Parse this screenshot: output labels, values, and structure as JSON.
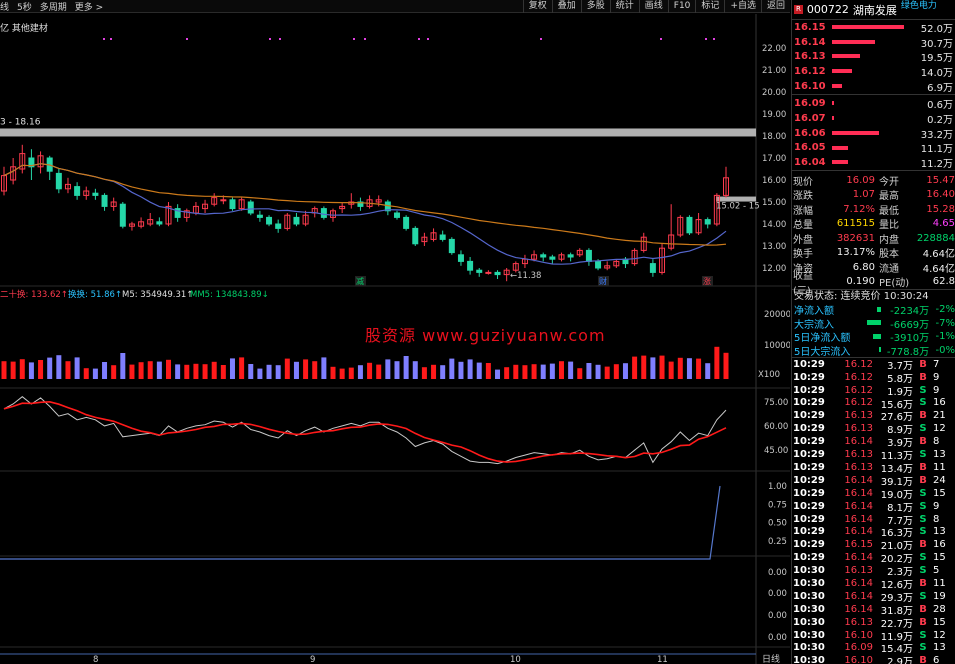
{
  "toolbar": {
    "left": [
      "线",
      "5秒",
      "多周期",
      "更多 >"
    ],
    "right": [
      "复权",
      "叠加",
      "多股",
      "统计",
      "画线",
      "F10",
      "标记",
      "+自选",
      "返回"
    ]
  },
  "chart": {
    "sector_label": "亿 其他建材",
    "range_label": "3 - 18.16",
    "high_annot": "15.02 - 15",
    "low_annot": "←11.38",
    "price_axis": [
      "22.00",
      "21.00",
      "20.00",
      "19.00",
      "18.00",
      "17.00",
      "16.00",
      "15.00",
      "14.00",
      "13.00",
      "12.00"
    ],
    "markers": [
      "减",
      "财",
      "涨"
    ],
    "vol_legend": {
      "a": "二十换: 133.62↑",
      "b": "换换: 51.86↑",
      "c": "M5: 354949.31↑",
      "d": "MM5: 134843.89↓"
    },
    "vol_axis": [
      "20000",
      "10000",
      "X100"
    ],
    "osc_axis": [
      "75.00",
      "60.00",
      "45.00"
    ],
    "ind_axis": [
      "1.00",
      "0.75",
      "0.50",
      "0.25"
    ],
    "ind2_axis": [
      "0.00",
      "0.00",
      "0.00",
      "0.00"
    ],
    "date_axis": [
      "8",
      "9",
      "10",
      "11"
    ],
    "period_label": "日线",
    "watermark": "股资源 www.guziyuanw.com",
    "colors": {
      "up": "#ff3b4e",
      "down": "#25d7a8",
      "ma_blue": "#5566cc",
      "ma_orange": "#cc7a1a"
    }
  },
  "chart_data": {
    "type": "candlestick",
    "ylim": [
      11,
      22.5
    ],
    "candles": [
      {
        "o": 15.5,
        "c": 16.2,
        "h": 16.6,
        "l": 15.3
      },
      {
        "o": 16.0,
        "c": 16.6,
        "h": 17.0,
        "l": 15.8
      },
      {
        "o": 16.5,
        "c": 17.2,
        "h": 17.6,
        "l": 16.3
      },
      {
        "o": 17.0,
        "c": 16.6,
        "h": 17.4,
        "l": 16.0
      },
      {
        "o": 16.6,
        "c": 17.1,
        "h": 17.3,
        "l": 16.3
      },
      {
        "o": 17.0,
        "c": 16.4,
        "h": 17.1,
        "l": 16.0
      },
      {
        "o": 16.3,
        "c": 15.6,
        "h": 16.5,
        "l": 15.4
      },
      {
        "o": 15.6,
        "c": 15.8,
        "h": 16.1,
        "l": 15.4
      },
      {
        "o": 15.7,
        "c": 15.3,
        "h": 15.9,
        "l": 15.1
      },
      {
        "o": 15.3,
        "c": 15.5,
        "h": 15.7,
        "l": 15.1
      },
      {
        "o": 15.4,
        "c": 15.3,
        "h": 15.6,
        "l": 15.1
      },
      {
        "o": 15.3,
        "c": 14.8,
        "h": 15.4,
        "l": 14.6
      },
      {
        "o": 14.8,
        "c": 15.0,
        "h": 15.2,
        "l": 14.6
      },
      {
        "o": 14.9,
        "c": 13.9,
        "h": 15.0,
        "l": 13.8
      },
      {
        "o": 13.9,
        "c": 14.0,
        "h": 14.1,
        "l": 13.7
      },
      {
        "o": 13.9,
        "c": 14.1,
        "h": 14.3,
        "l": 13.8
      },
      {
        "o": 14.0,
        "c": 14.2,
        "h": 14.5,
        "l": 13.9
      },
      {
        "o": 14.1,
        "c": 14.0,
        "h": 14.3,
        "l": 13.9
      },
      {
        "o": 14.0,
        "c": 14.8,
        "h": 15.0,
        "l": 13.9
      },
      {
        "o": 14.7,
        "c": 14.3,
        "h": 14.9,
        "l": 14.1
      },
      {
        "o": 14.3,
        "c": 14.6,
        "h": 14.7,
        "l": 14.1
      },
      {
        "o": 14.5,
        "c": 14.8,
        "h": 15.0,
        "l": 14.4
      },
      {
        "o": 14.7,
        "c": 14.9,
        "h": 15.1,
        "l": 14.5
      },
      {
        "o": 14.9,
        "c": 15.2,
        "h": 15.4,
        "l": 14.8
      },
      {
        "o": 15.1,
        "c": 15.1,
        "h": 15.3,
        "l": 14.9
      },
      {
        "o": 15.1,
        "c": 14.7,
        "h": 15.2,
        "l": 14.6
      },
      {
        "o": 14.7,
        "c": 15.1,
        "h": 15.2,
        "l": 14.6
      },
      {
        "o": 15.0,
        "c": 14.5,
        "h": 15.1,
        "l": 14.4
      },
      {
        "o": 14.4,
        "c": 14.3,
        "h": 14.6,
        "l": 14.1
      },
      {
        "o": 14.3,
        "c": 14.0,
        "h": 14.4,
        "l": 13.9
      },
      {
        "o": 14.0,
        "c": 13.8,
        "h": 14.2,
        "l": 13.6
      },
      {
        "o": 13.8,
        "c": 14.4,
        "h": 14.5,
        "l": 13.7
      },
      {
        "o": 14.3,
        "c": 14.0,
        "h": 14.5,
        "l": 13.9
      },
      {
        "o": 14.0,
        "c": 14.4,
        "h": 14.6,
        "l": 13.9
      },
      {
        "o": 14.5,
        "c": 14.7,
        "h": 14.8,
        "l": 14.3
      },
      {
        "o": 14.7,
        "c": 14.3,
        "h": 14.8,
        "l": 14.2
      },
      {
        "o": 14.3,
        "c": 14.6,
        "h": 14.7,
        "l": 14.1
      },
      {
        "o": 14.7,
        "c": 14.8,
        "h": 15.0,
        "l": 14.5
      },
      {
        "o": 14.9,
        "c": 15.0,
        "h": 15.4,
        "l": 14.7
      },
      {
        "o": 15.0,
        "c": 14.8,
        "h": 15.2,
        "l": 14.6
      },
      {
        "o": 14.8,
        "c": 15.1,
        "h": 15.3,
        "l": 14.7
      },
      {
        "o": 15.0,
        "c": 15.1,
        "h": 15.3,
        "l": 14.8
      },
      {
        "o": 15.0,
        "c": 14.6,
        "h": 15.1,
        "l": 14.4
      },
      {
        "o": 14.5,
        "c": 14.3,
        "h": 14.6,
        "l": 14.2
      },
      {
        "o": 14.3,
        "c": 13.8,
        "h": 14.4,
        "l": 13.7
      },
      {
        "o": 13.8,
        "c": 13.1,
        "h": 13.9,
        "l": 13.0
      },
      {
        "o": 13.2,
        "c": 13.4,
        "h": 13.6,
        "l": 13.0
      },
      {
        "o": 13.3,
        "c": 13.6,
        "h": 13.8,
        "l": 13.2
      },
      {
        "o": 13.5,
        "c": 13.3,
        "h": 13.7,
        "l": 13.2
      },
      {
        "o": 13.3,
        "c": 12.7,
        "h": 13.4,
        "l": 12.6
      },
      {
        "o": 12.6,
        "c": 12.3,
        "h": 12.8,
        "l": 12.1
      },
      {
        "o": 12.3,
        "c": 11.9,
        "h": 12.5,
        "l": 11.7
      },
      {
        "o": 11.9,
        "c": 11.8,
        "h": 12.0,
        "l": 11.6
      },
      {
        "o": 11.8,
        "c": 11.8,
        "h": 11.9,
        "l": 11.7
      },
      {
        "o": 11.8,
        "c": 11.7,
        "h": 11.9,
        "l": 11.5
      },
      {
        "o": 11.7,
        "c": 11.9,
        "h": 12.0,
        "l": 11.4
      },
      {
        "o": 11.9,
        "c": 12.2,
        "h": 12.3,
        "l": 11.8
      },
      {
        "o": 12.2,
        "c": 12.4,
        "h": 12.6,
        "l": 12.0
      },
      {
        "o": 12.4,
        "c": 12.6,
        "h": 12.8,
        "l": 12.3
      },
      {
        "o": 12.6,
        "c": 12.5,
        "h": 12.7,
        "l": 12.3
      },
      {
        "o": 12.5,
        "c": 12.4,
        "h": 12.6,
        "l": 12.2
      },
      {
        "o": 12.4,
        "c": 12.6,
        "h": 12.7,
        "l": 12.3
      },
      {
        "o": 12.6,
        "c": 12.5,
        "h": 12.7,
        "l": 12.3
      },
      {
        "o": 12.6,
        "c": 12.8,
        "h": 12.9,
        "l": 12.5
      },
      {
        "o": 12.8,
        "c": 12.3,
        "h": 12.9,
        "l": 12.1
      },
      {
        "o": 12.3,
        "c": 12.0,
        "h": 12.4,
        "l": 11.9
      },
      {
        "o": 12.0,
        "c": 12.1,
        "h": 12.3,
        "l": 11.9
      },
      {
        "o": 12.1,
        "c": 12.3,
        "h": 12.4,
        "l": 12.0
      },
      {
        "o": 12.4,
        "c": 12.2,
        "h": 12.5,
        "l": 12.0
      },
      {
        "o": 12.2,
        "c": 12.8,
        "h": 12.9,
        "l": 12.1
      },
      {
        "o": 12.8,
        "c": 13.4,
        "h": 13.6,
        "l": 12.7
      },
      {
        "o": 12.2,
        "c": 11.8,
        "h": 12.4,
        "l": 11.6
      },
      {
        "o": 11.8,
        "c": 12.9,
        "h": 13.1,
        "l": 11.7
      },
      {
        "o": 12.9,
        "c": 13.5,
        "h": 14.9,
        "l": 12.8
      },
      {
        "o": 13.5,
        "c": 14.3,
        "h": 14.4,
        "l": 13.4
      },
      {
        "o": 14.3,
        "c": 13.6,
        "h": 14.4,
        "l": 13.5
      },
      {
        "o": 13.6,
        "c": 14.2,
        "h": 14.5,
        "l": 13.5
      },
      {
        "o": 14.2,
        "c": 14.0,
        "h": 14.3,
        "l": 13.8
      },
      {
        "o": 14.0,
        "c": 15.3,
        "h": 15.4,
        "l": 13.9
      },
      {
        "o": 15.3,
        "c": 16.1,
        "h": 16.6,
        "l": 15.2
      }
    ]
  },
  "orderbook": {
    "code": "000722",
    "name": "湖南发展",
    "alt": "绿色电力",
    "rows": [
      {
        "price": "16.15",
        "vol": "52.0万",
        "w": 0.92
      },
      {
        "price": "16.14",
        "vol": "30.7万",
        "w": 0.55
      },
      {
        "price": "16.13",
        "vol": "19.5万",
        "w": 0.36
      },
      {
        "price": "16.12",
        "vol": "14.0万",
        "w": 0.26
      },
      {
        "price": "16.10",
        "vol": "6.9万",
        "w": 0.13
      },
      {
        "price": "16.09",
        "vol": "0.6万",
        "w": 0.02
      },
      {
        "price": "16.07",
        "vol": "0.2万",
        "w": 0.01
      },
      {
        "price": "16.06",
        "vol": "33.2万",
        "w": 0.6
      },
      {
        "price": "16.05",
        "vol": "11.1万",
        "w": 0.2
      },
      {
        "price": "16.04",
        "vol": "11.2万",
        "w": 0.2
      }
    ]
  },
  "quote": [
    {
      "k": "现价",
      "v": "16.09",
      "vc": "red",
      "k2": "今开",
      "v2": "15.47",
      "v2c": "red"
    },
    {
      "k": "涨跌",
      "v": "1.07",
      "vc": "red",
      "k2": "最高",
      "v2": "16.40",
      "v2c": "red"
    },
    {
      "k": "涨幅",
      "v": "7.12%",
      "vc": "red",
      "k2": "最低",
      "v2": "15.28",
      "v2c": "red"
    },
    {
      "k": "总量",
      "v": "611515",
      "vc": "yellow",
      "k2": "量比",
      "v2": "4.65",
      "v2c": "mag"
    },
    {
      "k": "外盘",
      "v": "382631",
      "vc": "red",
      "k2": "内盘",
      "v2": "228884",
      "v2c": "green"
    },
    {
      "k": "换手",
      "v": "13.17%",
      "vc": "white",
      "k2": "股本",
      "v2": "4.64亿",
      "v2c": "white"
    },
    {
      "k": "净资",
      "v": "6.80",
      "vc": "white",
      "k2": "流通",
      "v2": "4.64亿",
      "v2c": "white"
    },
    {
      "k": "收益(三)",
      "v": "0.190",
      "vc": "white",
      "k2": "PE(动)",
      "v2": "62.8",
      "v2c": "white"
    }
  ],
  "trade_status": "交易状态: 连续竞价 10:30:24",
  "flows": [
    {
      "label": "净流入额",
      "val": "-2234万",
      "pct": "-2%",
      "w": 4
    },
    {
      "label": "大宗流入",
      "val": "-6669万",
      "pct": "-7%",
      "w": 14
    },
    {
      "label": "5日净流入额",
      "val": "-3910万",
      "pct": "-1%",
      "w": 8
    },
    {
      "label": "5日大宗流入",
      "val": "-778.8万",
      "pct": "-0%",
      "w": 2
    }
  ],
  "ticks": [
    {
      "t": "10:29",
      "p": "16.12",
      "v": "3.7万",
      "s": "B",
      "n": "7"
    },
    {
      "t": "10:29",
      "p": "16.12",
      "v": "5.8万",
      "s": "B",
      "n": "9"
    },
    {
      "t": "10:29",
      "p": "16.12",
      "v": "1.9万",
      "s": "S",
      "n": "9"
    },
    {
      "t": "10:29",
      "p": "16.12",
      "v": "15.6万",
      "s": "S",
      "n": "16"
    },
    {
      "t": "10:29",
      "p": "16.13",
      "v": "27.6万",
      "s": "B",
      "n": "21"
    },
    {
      "t": "10:29",
      "p": "16.13",
      "v": "8.9万",
      "s": "S",
      "n": "12"
    },
    {
      "t": "10:29",
      "p": "16.14",
      "v": "3.9万",
      "s": "B",
      "n": "8"
    },
    {
      "t": "10:29",
      "p": "16.13",
      "v": "11.3万",
      "s": "S",
      "n": "13"
    },
    {
      "t": "10:29",
      "p": "16.13",
      "v": "13.4万",
      "s": "B",
      "n": "11"
    },
    {
      "t": "10:29",
      "p": "16.14",
      "v": "39.1万",
      "s": "B",
      "n": "24"
    },
    {
      "t": "10:29",
      "p": "16.14",
      "v": "19.0万",
      "s": "S",
      "n": "15"
    },
    {
      "t": "10:29",
      "p": "16.14",
      "v": "8.1万",
      "s": "S",
      "n": "9"
    },
    {
      "t": "10:29",
      "p": "16.14",
      "v": "7.7万",
      "s": "S",
      "n": "8"
    },
    {
      "t": "10:29",
      "p": "16.14",
      "v": "16.3万",
      "s": "S",
      "n": "13"
    },
    {
      "t": "10:29",
      "p": "16.15",
      "v": "21.0万",
      "s": "B",
      "n": "16"
    },
    {
      "t": "10:29",
      "p": "16.14",
      "v": "20.2万",
      "s": "S",
      "n": "15"
    },
    {
      "t": "10:30",
      "p": "16.13",
      "v": "2.3万",
      "s": "S",
      "n": "5"
    },
    {
      "t": "10:30",
      "p": "16.14",
      "v": "12.6万",
      "s": "B",
      "n": "11"
    },
    {
      "t": "10:30",
      "p": "16.14",
      "v": "29.3万",
      "s": "S",
      "n": "19"
    },
    {
      "t": "10:30",
      "p": "16.14",
      "v": "31.8万",
      "s": "B",
      "n": "28"
    },
    {
      "t": "10:30",
      "p": "16.13",
      "v": "22.7万",
      "s": "B",
      "n": "15"
    },
    {
      "t": "10:30",
      "p": "16.10",
      "v": "11.9万",
      "s": "S",
      "n": "12"
    },
    {
      "t": "10:30",
      "p": "16.09",
      "v": "15.4万",
      "s": "S",
      "n": "13"
    },
    {
      "t": "10:30",
      "p": "16.10",
      "v": "2.9万",
      "s": "B",
      "n": "6"
    }
  ]
}
